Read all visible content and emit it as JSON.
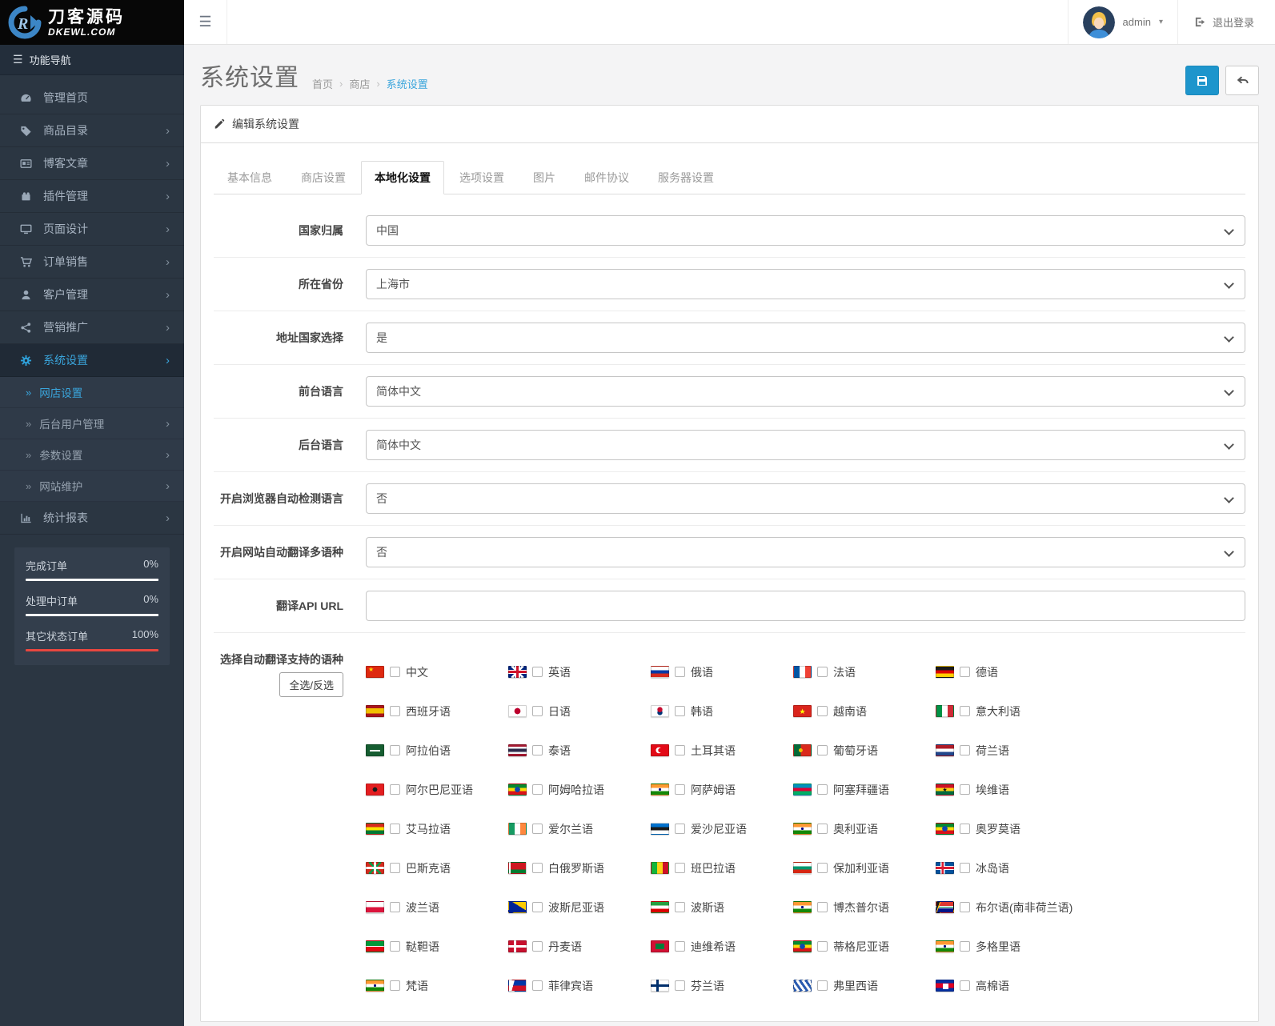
{
  "colors": {
    "accent_blue": "#1d95cc",
    "link_blue": "#3aa5dc",
    "progress_red": "#e8473f",
    "progress_white": "#ffffff",
    "sidebar_bg": "#2b3642"
  },
  "brand": {
    "title": "刀客源码",
    "subtitle": "DKEWL.COM"
  },
  "topbar": {
    "username": "admin",
    "logout_label": "退出登录"
  },
  "sidebar": {
    "nav_header": "功能导航",
    "items": [
      {
        "key": "dashboard",
        "label": "管理首页",
        "icon": "gauge-icon",
        "chevron": false
      },
      {
        "key": "catalog",
        "label": "商品目录",
        "icon": "tags-icon",
        "chevron": true
      },
      {
        "key": "blog",
        "label": "博客文章",
        "icon": "newspaper-icon",
        "chevron": true
      },
      {
        "key": "extensions",
        "label": "插件管理",
        "icon": "puzzle-icon",
        "chevron": true
      },
      {
        "key": "design",
        "label": "页面设计",
        "icon": "desktop-icon",
        "chevron": true
      },
      {
        "key": "sales",
        "label": "订单销售",
        "icon": "cart-icon",
        "chevron": true
      },
      {
        "key": "customers",
        "label": "客户管理",
        "icon": "user-icon",
        "chevron": true
      },
      {
        "key": "marketing",
        "label": "营销推广",
        "icon": "share-icon",
        "chevron": true
      },
      {
        "key": "system",
        "label": "系统设置",
        "icon": "gear-icon",
        "chevron": true,
        "active": true,
        "children": [
          {
            "key": "store-settings",
            "label": "网店设置",
            "active": true,
            "chevron": false
          },
          {
            "key": "admin-users",
            "label": "后台用户管理",
            "chevron": true
          },
          {
            "key": "parameters",
            "label": "参数设置",
            "chevron": true
          },
          {
            "key": "maintenance",
            "label": "网站维护",
            "chevron": true
          }
        ]
      },
      {
        "key": "reports",
        "label": "统计报表",
        "icon": "chart-icon",
        "chevron": true
      }
    ],
    "order_stats": [
      {
        "label": "完成订单",
        "value": "0%",
        "bar_color": "#ffffff"
      },
      {
        "label": "处理中订单",
        "value": "0%",
        "bar_color": "#ffffff"
      },
      {
        "label": "其它状态订单",
        "value": "100%",
        "bar_color": "#e8473f"
      }
    ]
  },
  "page": {
    "title": "系统设置",
    "breadcrumb": [
      "首页",
      "商店",
      "系统设置"
    ]
  },
  "panel": {
    "heading": "编辑系统设置",
    "tabs": [
      {
        "key": "basic",
        "label": "基本信息"
      },
      {
        "key": "store",
        "label": "商店设置"
      },
      {
        "key": "localization",
        "label": "本地化设置",
        "active": true
      },
      {
        "key": "options",
        "label": "选项设置"
      },
      {
        "key": "images",
        "label": "图片"
      },
      {
        "key": "mail",
        "label": "邮件协议"
      },
      {
        "key": "server",
        "label": "服务器设置"
      }
    ]
  },
  "form": {
    "fields": [
      {
        "key": "country",
        "label": "国家归属",
        "type": "select",
        "value": "中国"
      },
      {
        "key": "province",
        "label": "所在省份",
        "type": "select",
        "value": "上海市"
      },
      {
        "key": "address-country",
        "label": "地址国家选择",
        "type": "select",
        "value": "是"
      },
      {
        "key": "frontend-language",
        "label": "前台语言",
        "type": "select",
        "value": "简体中文"
      },
      {
        "key": "backend-language",
        "label": "后台语言",
        "type": "select",
        "value": "简体中文"
      },
      {
        "key": "browser-language-detect",
        "label": "开启浏览器自动检测语言",
        "type": "select",
        "value": "否"
      },
      {
        "key": "auto-translate",
        "label": "开启网站自动翻译多语种",
        "type": "select",
        "value": "否"
      },
      {
        "key": "translate-api-url",
        "label": "翻译API URL",
        "type": "text",
        "value": ""
      }
    ],
    "languages_label": "选择自动翻译支持的语种",
    "select_all_label": "全选/反选",
    "languages": [
      {
        "name": "中文",
        "flag": "cn",
        "checked": false
      },
      {
        "name": "英语",
        "flag": "gb",
        "checked": false
      },
      {
        "name": "俄语",
        "flag": "ru",
        "checked": false
      },
      {
        "name": "法语",
        "flag": "fr",
        "checked": false
      },
      {
        "name": "德语",
        "flag": "de",
        "checked": false
      },
      {
        "name": "西班牙语",
        "flag": "es",
        "checked": false
      },
      {
        "name": "日语",
        "flag": "jp",
        "checked": false
      },
      {
        "name": "韩语",
        "flag": "kr",
        "checked": false
      },
      {
        "name": "越南语",
        "flag": "vn",
        "checked": false
      },
      {
        "name": "意大利语",
        "flag": "it",
        "checked": false
      },
      {
        "name": "阿拉伯语",
        "flag": "sa",
        "checked": false
      },
      {
        "name": "泰语",
        "flag": "th",
        "checked": false
      },
      {
        "name": "土耳其语",
        "flag": "tr",
        "checked": false
      },
      {
        "name": "葡萄牙语",
        "flag": "pt",
        "checked": false
      },
      {
        "name": "荷兰语",
        "flag": "nl",
        "checked": false
      },
      {
        "name": "阿尔巴尼亚语",
        "flag": "al",
        "checked": false
      },
      {
        "name": "阿姆哈拉语",
        "flag": "et",
        "checked": false
      },
      {
        "name": "阿萨姆语",
        "flag": "in",
        "checked": false
      },
      {
        "name": "阿塞拜疆语",
        "flag": "az",
        "checked": false
      },
      {
        "name": "埃维语",
        "flag": "gh",
        "checked": false
      },
      {
        "name": "艾马拉语",
        "flag": "bo",
        "checked": false
      },
      {
        "name": "爱尔兰语",
        "flag": "ie",
        "checked": false
      },
      {
        "name": "爱沙尼亚语",
        "flag": "ee",
        "checked": false
      },
      {
        "name": "奥利亚语",
        "flag": "in",
        "checked": false
      },
      {
        "name": "奥罗莫语",
        "flag": "et",
        "checked": false
      },
      {
        "name": "巴斯克语",
        "flag": "eu",
        "checked": false
      },
      {
        "name": "白俄罗斯语",
        "flag": "by",
        "checked": false
      },
      {
        "name": "班巴拉语",
        "flag": "ml",
        "checked": false
      },
      {
        "name": "保加利亚语",
        "flag": "bg",
        "checked": false
      },
      {
        "name": "冰岛语",
        "flag": "is",
        "checked": false
      },
      {
        "name": "波兰语",
        "flag": "pl",
        "checked": false
      },
      {
        "name": "波斯尼亚语",
        "flag": "ba",
        "checked": false
      },
      {
        "name": "波斯语",
        "flag": "ir",
        "checked": false
      },
      {
        "name": "博杰普尔语",
        "flag": "in",
        "checked": false
      },
      {
        "name": "布尔语(南非荷兰语)",
        "flag": "za",
        "checked": false
      },
      {
        "name": "鞑靼语",
        "flag": "tt",
        "checked": false
      },
      {
        "name": "丹麦语",
        "flag": "dk",
        "checked": false
      },
      {
        "name": "迪维希语",
        "flag": "mv",
        "checked": false
      },
      {
        "name": "蒂格尼亚语",
        "flag": "et",
        "checked": false
      },
      {
        "name": "多格里语",
        "flag": "in",
        "checked": false
      },
      {
        "name": "梵语",
        "flag": "in",
        "checked": false
      },
      {
        "name": "菲律宾语",
        "flag": "ph",
        "checked": false
      },
      {
        "name": "芬兰语",
        "flag": "fi",
        "checked": false
      },
      {
        "name": "弗里西语",
        "flag": "fy",
        "checked": false
      },
      {
        "name": "高棉语",
        "flag": "kh",
        "checked": false
      }
    ]
  }
}
